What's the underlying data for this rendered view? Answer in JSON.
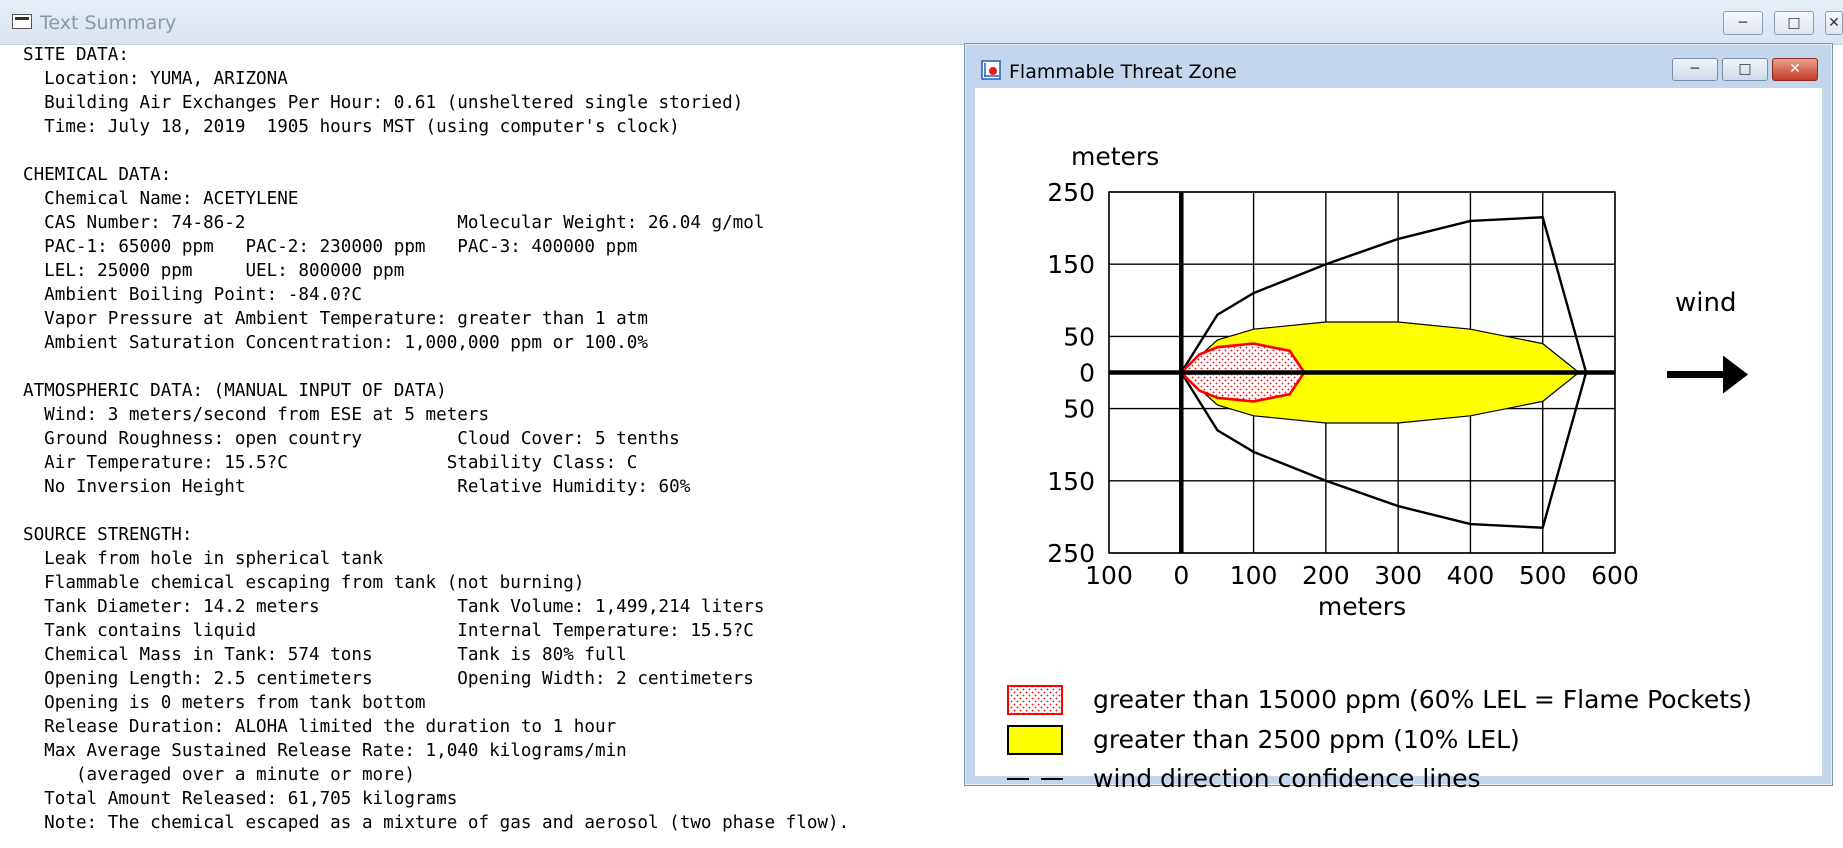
{
  "window": {
    "title": "Text Summary",
    "buttons": {
      "minimize": "─",
      "maximize": "□",
      "close": "✕"
    }
  },
  "summary_lines": [
    "SITE DATA:",
    "  Location: YUMA, ARIZONA",
    "  Building Air Exchanges Per Hour: 0.61 (unsheltered single storied)",
    "  Time: July 18, 2019  1905 hours MST (using computer's clock)",
    "",
    "CHEMICAL DATA:",
    "  Chemical Name: ACETYLENE",
    "  CAS Number: 74-86-2                    Molecular Weight: 26.04 g/mol",
    "  PAC-1: 65000 ppm   PAC-2: 230000 ppm   PAC-3: 400000 ppm",
    "  LEL: 25000 ppm     UEL: 800000 ppm",
    "  Ambient Boiling Point: -84.0?C",
    "  Vapor Pressure at Ambient Temperature: greater than 1 atm",
    "  Ambient Saturation Concentration: 1,000,000 ppm or 100.0%",
    "",
    "ATMOSPHERIC DATA: (MANUAL INPUT OF DATA)",
    "  Wind: 3 meters/second from ESE at 5 meters",
    "  Ground Roughness: open country         Cloud Cover: 5 tenths",
    "  Air Temperature: 15.5?C               Stability Class: C",
    "  No Inversion Height                    Relative Humidity: 60%",
    "",
    "SOURCE STRENGTH:",
    "  Leak from hole in spherical tank",
    "  Flammable chemical escaping from tank (not burning)",
    "  Tank Diameter: 14.2 meters             Tank Volume: 1,499,214 liters",
    "  Tank contains liquid                   Internal Temperature: 15.5?C",
    "  Chemical Mass in Tank: 574 tons        Tank is 80% full",
    "  Opening Length: 2.5 centimeters        Opening Width: 2 centimeters",
    "  Opening is 0 meters from tank bottom",
    "  Release Duration: ALOHA limited the duration to 1 hour",
    "  Max Average Sustained Release Rate: 1,040 kilograms/min",
    "     (averaged over a minute or more)",
    "  Total Amount Released: 61,705 kilograms",
    "  Note: The chemical escaped as a mixture of gas and aerosol (two phase flow)."
  ],
  "threat_zone": {
    "title": "Flammable Threat Zone",
    "buttons": {
      "minimize": "─",
      "maximize": "□",
      "close": "✕"
    },
    "y_unit": "meters",
    "x_unit": "meters",
    "y_ticks": [
      "250",
      "150",
      "50",
      "0",
      "50",
      "150",
      "250"
    ],
    "x_ticks": [
      "100",
      "0",
      "100",
      "200",
      "300",
      "400",
      "500",
      "600"
    ],
    "wind_label": "wind",
    "legend": [
      {
        "text": "greater than 15000 ppm (60% LEL = Flame Pockets)",
        "color": "#ff0000"
      },
      {
        "text": "greater than 2500 ppm (10% LEL)",
        "color": "#ffff00"
      },
      {
        "text": "wind direction confidence lines",
        "color": "#000000"
      }
    ]
  },
  "chart_data": {
    "type": "area",
    "xlabel": "meters",
    "ylabel": "meters",
    "xlim": [
      -100,
      600
    ],
    "ylim": [
      -250,
      250
    ],
    "series": [
      {
        "name": "greater than 15000 ppm (60% LEL = Flame Pockets)",
        "x": [
          0,
          25,
          50,
          100,
          150,
          170
        ],
        "y_half_width": [
          0,
          25,
          35,
          40,
          30,
          0
        ]
      },
      {
        "name": "greater than 2500 ppm (10% LEL)",
        "x": [
          0,
          50,
          100,
          200,
          300,
          400,
          500,
          550
        ],
        "y_half_width": [
          0,
          45,
          60,
          70,
          70,
          60,
          40,
          0
        ]
      },
      {
        "name": "wind direction confidence lines",
        "x": [
          0,
          50,
          100,
          200,
          300,
          400,
          500,
          560
        ],
        "y_half_width": [
          0,
          80,
          110,
          150,
          185,
          210,
          215,
          0
        ]
      }
    ]
  }
}
